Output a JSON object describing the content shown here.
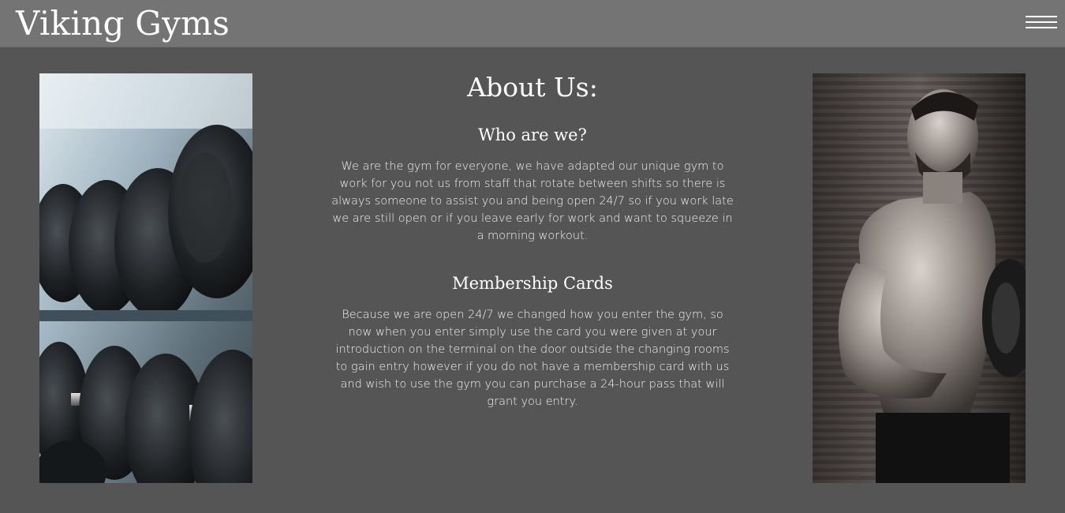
{
  "header": {
    "brand": "Viking Gyms",
    "menu_icon": "hamburger-menu-icon"
  },
  "images": {
    "left": "dumbbell-rack-photo",
    "right": "bodybuilder-curling-dumbbell-photo"
  },
  "about": {
    "title": "About Us:",
    "sections": [
      {
        "heading": "Who are we?",
        "body": "We are the gym for everyone, we have adapted our unique gym to work for you not us from staff that rotate between shifts so there is always someone to assist you and being open 24/7 so if you work late we are still open or if you leave early for work and want to squeeze in a morning workout."
      },
      {
        "heading": "Membership Cards",
        "body": "Because we are open 24/7 we changed how you enter the gym, so now when you enter simply use the card you were given at your introduction on the terminal on the door outside the changing rooms to gain entry however if you do not have a membership card with us and wish to use the gym you can purchase a 24-hour pass that will grant you entry."
      }
    ]
  },
  "colors": {
    "background": "#555555",
    "header": "#747474",
    "text": "#ffffff"
  }
}
